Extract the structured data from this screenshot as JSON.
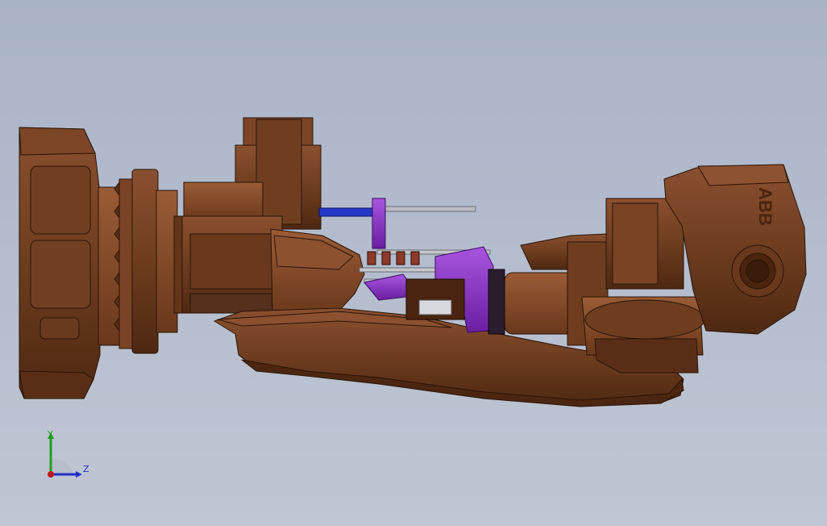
{
  "viewport": {
    "background_top": "#a9b3c6",
    "background_bottom": "#c0c6d3"
  },
  "model": {
    "arm_color": "#6e3d1f",
    "fixture_color": "#8a2fc4",
    "logo_text": "ABB"
  },
  "triad": {
    "y_label": "Y",
    "z_label": "Z",
    "y_color": "#1e9e1e",
    "z_color": "#2030c8",
    "x_color": "#c01818"
  }
}
